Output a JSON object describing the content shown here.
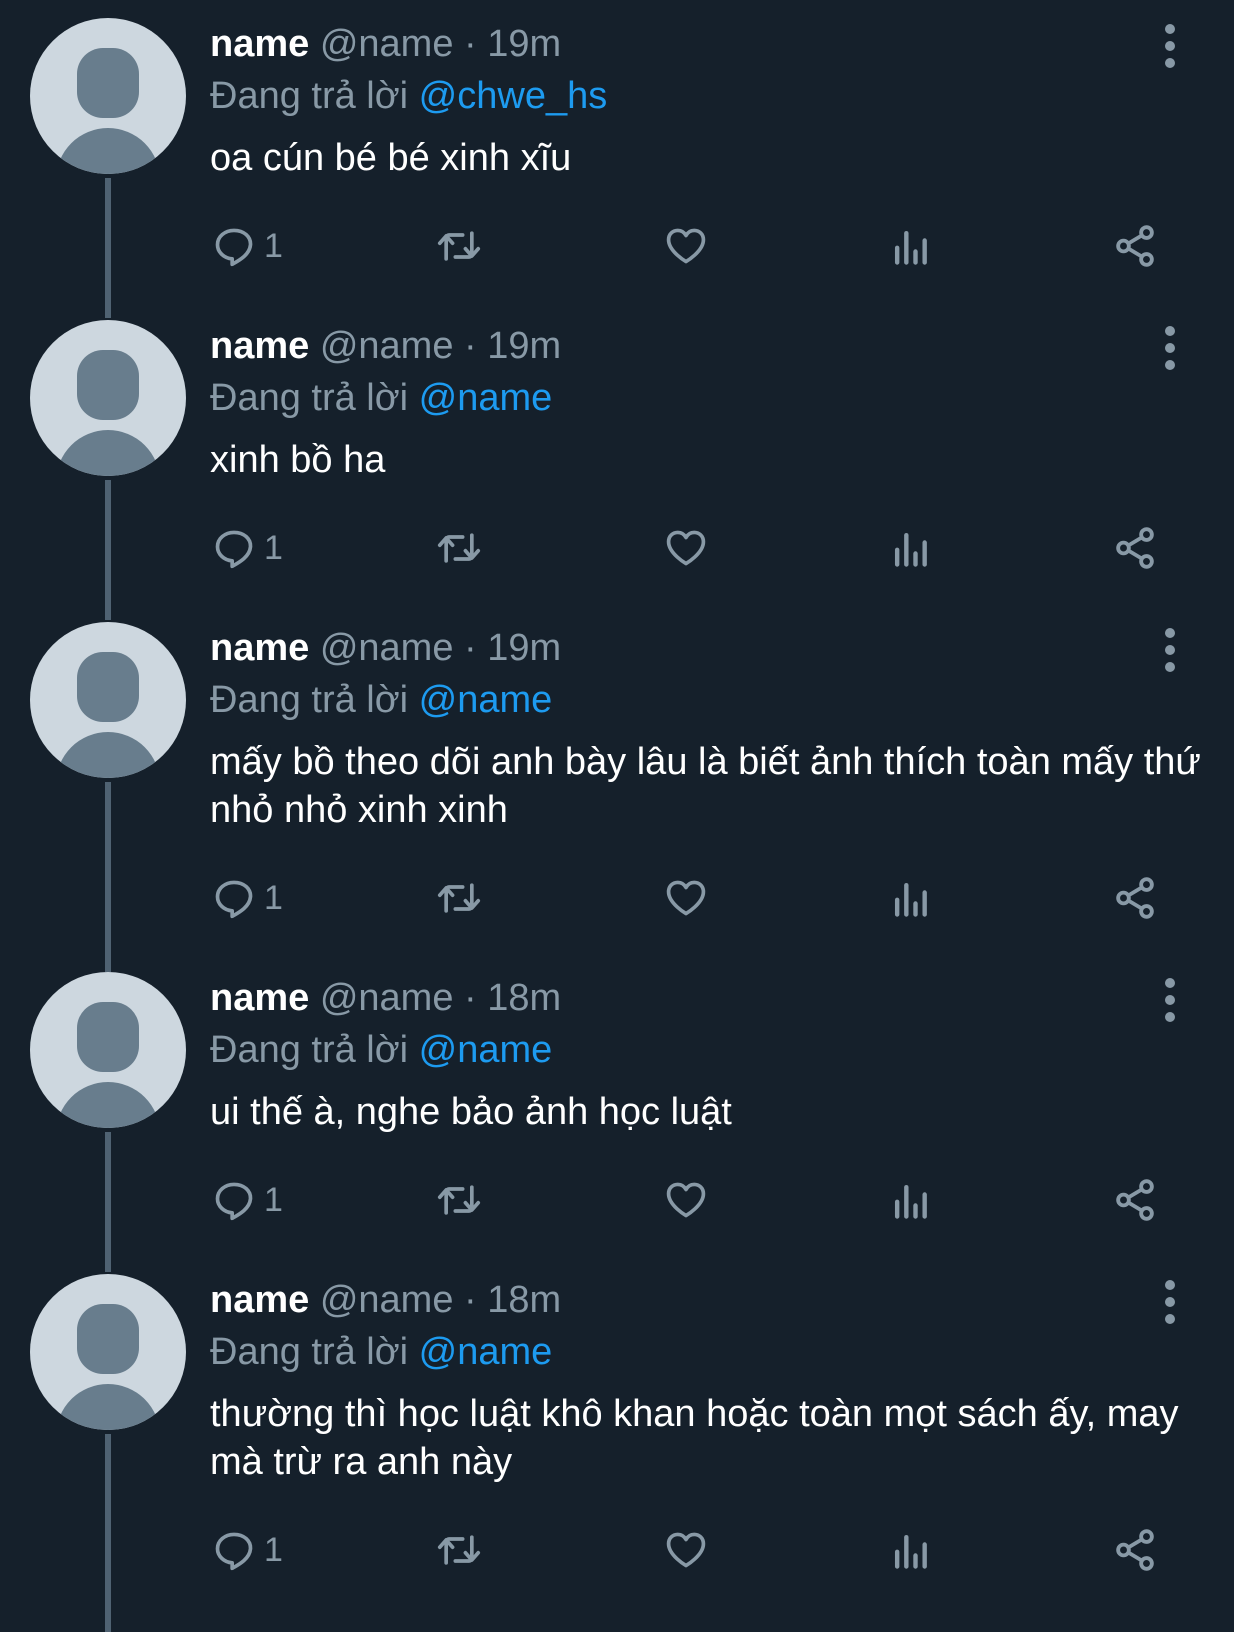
{
  "tweets": [
    {
      "display_name": "name",
      "handle": "@name",
      "separator": "·",
      "time": "19m",
      "replying_prefix": "Đang trả lời",
      "replying_to": "@chwe_hs",
      "text": "oa cún bé bé xinh xĩu",
      "reply_count": "1"
    },
    {
      "display_name": "name",
      "handle": "@name",
      "separator": "·",
      "time": "19m",
      "replying_prefix": "Đang trả lời",
      "replying_to": "@name",
      "text": "xinh bồ ha",
      "reply_count": "1"
    },
    {
      "display_name": "name",
      "handle": "@name",
      "separator": "·",
      "time": "19m",
      "replying_prefix": "Đang trả lời",
      "replying_to": "@name",
      "text": "mấy bồ theo dõi anh bày lâu là biết ảnh thích toàn mấy thứ nhỏ nhỏ xinh xinh",
      "reply_count": "1"
    },
    {
      "display_name": "name",
      "handle": "@name",
      "separator": "·",
      "time": "18m",
      "replying_prefix": "Đang trả lời",
      "replying_to": "@name",
      "text": "ui thế à, nghe bảo ảnh học luật",
      "reply_count": "1"
    },
    {
      "display_name": "name",
      "handle": "@name",
      "separator": "·",
      "time": "18m",
      "replying_prefix": "Đang trả lời",
      "replying_to": "@name",
      "text": "thường thì học luật khô khan hoặc toàn mọt sách ấy, may mà trừ ra anh này",
      "reply_count": "1"
    }
  ],
  "icons": {
    "more": "more-vertical-icon",
    "reply": "reply-bubble-icon",
    "retweet": "retweet-icon",
    "like": "heart-icon",
    "views": "views-chart-icon",
    "share": "share-icon"
  },
  "colors": {
    "background": "#15202b",
    "primary_text": "#ffffff",
    "secondary_text": "#8899a6",
    "link": "#1d9bf0",
    "avatar_bg": "#cdd7df",
    "avatar_fg": "#687d8d"
  }
}
